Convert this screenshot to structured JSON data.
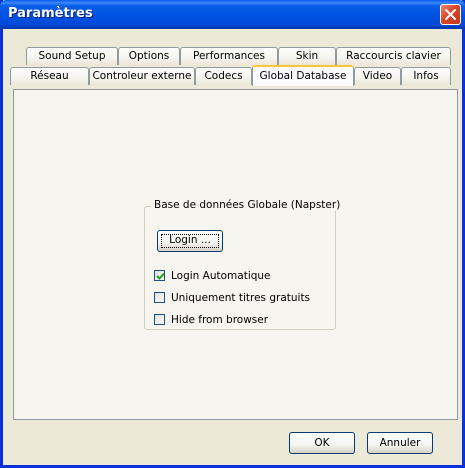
{
  "window": {
    "title": "Paramètres",
    "close_icon": "close-icon"
  },
  "tabs_row1": [
    {
      "label": "Sound Setup"
    },
    {
      "label": "Options"
    },
    {
      "label": "Performances"
    },
    {
      "label": "Skin"
    },
    {
      "label": "Raccourcis clavier"
    }
  ],
  "tabs_row2": [
    {
      "label": "Réseau"
    },
    {
      "label": "Controleur externe"
    },
    {
      "label": "Codecs"
    },
    {
      "label": "Global Database",
      "active": true
    },
    {
      "label": "Video"
    },
    {
      "label": "Infos"
    }
  ],
  "group": {
    "legend": "Base de données Globale (Napster)",
    "login_button": "Login ...",
    "checkboxes": [
      {
        "label": "Login Automatique",
        "checked": true
      },
      {
        "label": "Uniquement titres gratuits",
        "checked": false
      },
      {
        "label": "Hide from browser",
        "checked": false
      }
    ]
  },
  "buttons": {
    "ok": "OK",
    "cancel": "Annuler"
  },
  "colors": {
    "titlebar": "#0054e3",
    "active_tab_highlight": "#ffc73c",
    "dialog_bg": "#ece9d8"
  }
}
